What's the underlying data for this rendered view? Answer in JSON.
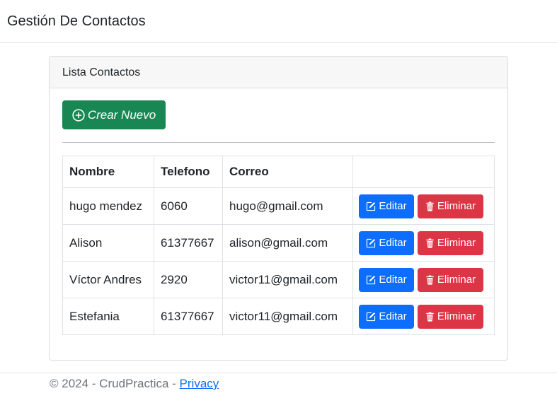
{
  "navbar": {
    "brand": "Gestión De Contactos"
  },
  "card": {
    "header": "Lista Contactos",
    "create_button_label": "Crear Nuevo",
    "table": {
      "headers": [
        "Nombre",
        "Telefono",
        "Correo",
        ""
      ],
      "rows": [
        {
          "nombre": "hugo mendez",
          "telefono": "6060",
          "correo": "hugo@gmail.com"
        },
        {
          "nombre": "Alison",
          "telefono": "61377667",
          "correo": "alison@gmail.com"
        },
        {
          "nombre": "Víctor Andres",
          "telefono": "2920",
          "correo": "victor11@gmail.com"
        },
        {
          "nombre": "Estefania",
          "telefono": "61377667",
          "correo": "victor11@gmail.com"
        }
      ],
      "edit_label": "Editar",
      "delete_label": "Eliminar"
    }
  },
  "footer": {
    "text": "© 2024 - CrudPractica - ",
    "privacy_link": "Privacy"
  },
  "colors": {
    "success": "#198754",
    "primary": "#0d6efd",
    "danger": "#dc3545"
  },
  "icons": {
    "create": "plus-circle-icon",
    "edit": "pencil-square-icon",
    "delete": "trash-icon"
  }
}
